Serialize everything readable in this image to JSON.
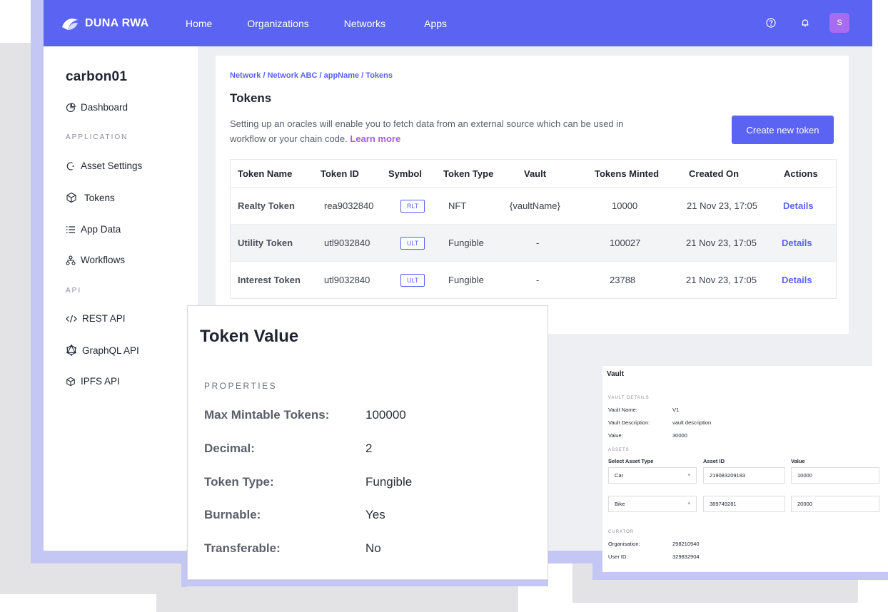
{
  "brand": {
    "name": "DUNA RWA"
  },
  "nav": [
    {
      "label": "Home"
    },
    {
      "label": "Organizations"
    },
    {
      "label": "Networks"
    },
    {
      "label": "Apps"
    }
  ],
  "user": {
    "avatar_initial": "S"
  },
  "sidebar": {
    "app_name": "carbon01",
    "dashboard": "Dashboard",
    "application_section": "APPLICATION",
    "asset_settings": "Asset Settings",
    "tokens": "Tokens",
    "app_data": "App Data",
    "workflows": "Workflows",
    "api_section": "API",
    "rest_api": "REST API",
    "graphql_api": "GraphQL API",
    "ipfs_api": "IPFS API"
  },
  "page": {
    "breadcrumb": "Network / Network ABC  / appName / Tokens",
    "title": "Tokens",
    "description": "Setting up an oracles will enable you to fetch data from an external source which can be used in workflow or your chain code.",
    "learn_more": "Learn more",
    "create_button": "Create new token"
  },
  "table": {
    "headers": {
      "name": "Token Name",
      "id": "Token ID",
      "symbol": "Symbol",
      "type": "Token Type",
      "vault": "Vault",
      "minted": "Tokens Minted",
      "created": "Created On",
      "actions": "Actions"
    },
    "rows": [
      {
        "name": "Realty Token",
        "id": "rea9032840",
        "symbol": "RLT",
        "type": "NFT",
        "vault": "{vaultName}",
        "minted": "10000",
        "created": "21 Nov 23, 17:05",
        "action": "Details"
      },
      {
        "name": "Utility Token",
        "id": "utl9032840",
        "symbol": "ULT",
        "type": "Fungible",
        "vault": "-",
        "minted": "100027",
        "created": "21 Nov 23, 17:05",
        "action": "Details"
      },
      {
        "name": "Interest Token",
        "id": "utl9032840",
        "symbol": "ULT",
        "type": "Fungible",
        "vault": "-",
        "minted": "23788",
        "created": "21 Nov 23, 17:05",
        "action": "Details"
      }
    ]
  },
  "token_value": {
    "title": "Token Value",
    "section": "PROPERTIES",
    "properties": [
      {
        "label": "Max Mintable Tokens:",
        "value": "100000"
      },
      {
        "label": "Decimal:",
        "value": "2"
      },
      {
        "label": "Token Type:",
        "value": "Fungible"
      },
      {
        "label": "Burnable:",
        "value": "Yes"
      },
      {
        "label": "Transferable:",
        "value": "No"
      }
    ]
  },
  "vault": {
    "title": "Vault",
    "details_section": "VAULT DETAILS",
    "name_label": "Vault Name:",
    "name_value": "V1",
    "desc_label": "Vault Description:",
    "desc_value": "vault description",
    "value_label": "Value:",
    "value_value": "30000",
    "assets_section": "ASSETS",
    "col_type": "Select Asset Type",
    "col_id": "Asset ID",
    "col_value": "Value",
    "assets": [
      {
        "type": "Car",
        "id": "219083209183",
        "value": "10000"
      },
      {
        "type": "Bike",
        "id": "389749281",
        "value": "20000"
      }
    ],
    "curator_section": "CURATOR",
    "org_label": "Organisation:",
    "org_value": "298210940",
    "user_label": "User ID:",
    "user_value": "329832904"
  }
}
